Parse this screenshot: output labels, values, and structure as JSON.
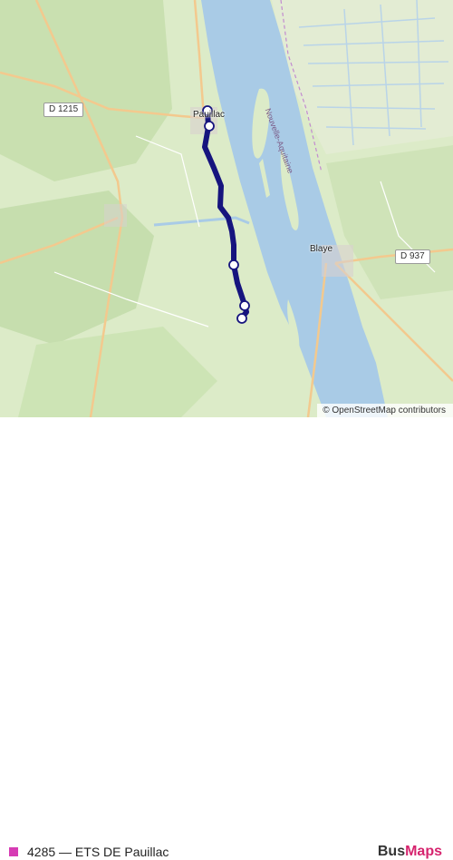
{
  "map": {
    "road_labels": [
      "D 1215",
      "D 937"
    ],
    "places": [
      "Pauillac",
      "Blaye"
    ],
    "region_label": "Nouvelle-Aquitaine",
    "attribution": "© OpenStreetMap contributors",
    "colors": {
      "water": "#a9cbe6",
      "land": "#dcebc8",
      "route": "#16147e",
      "road": "#f3c98e"
    }
  },
  "legend": {
    "label": "4285 — ETS DE Pauillac",
    "color": "#d63cb4"
  },
  "brand": {
    "part1": "Bus",
    "part2": "Maps"
  }
}
